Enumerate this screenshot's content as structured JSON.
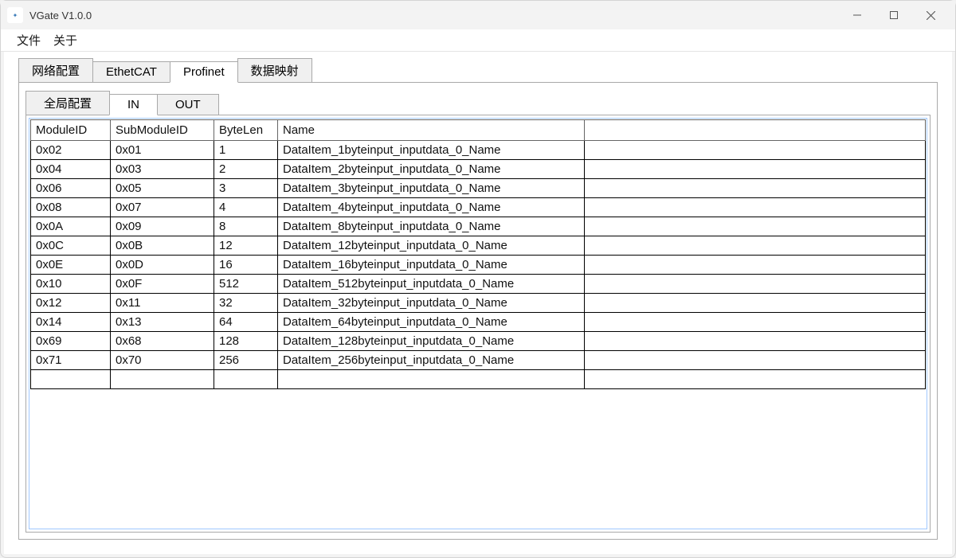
{
  "window": {
    "title": "VGate V1.0.0"
  },
  "menu": {
    "file": "文件",
    "about": "关于"
  },
  "tabs": {
    "network": "网络配置",
    "ethercat": "EthetCAT",
    "profinet": "Profinet",
    "mapping": "数据映射",
    "active": "profinet"
  },
  "subtabs": {
    "global": "全局配置",
    "in": "IN",
    "out": "OUT",
    "active": "in"
  },
  "table": {
    "headers": {
      "module": "ModuleID",
      "sub": "SubModuleID",
      "len": "ByteLen",
      "name": "Name"
    },
    "rows": [
      {
        "module": "0x02",
        "sub": "0x01",
        "len": "1",
        "name": "DataItem_1byteinput_inputdata_0_Name"
      },
      {
        "module": "0x04",
        "sub": "0x03",
        "len": "2",
        "name": "DataItem_2byteinput_inputdata_0_Name"
      },
      {
        "module": "0x06",
        "sub": "0x05",
        "len": "3",
        "name": "DataItem_3byteinput_inputdata_0_Name"
      },
      {
        "module": "0x08",
        "sub": "0x07",
        "len": "4",
        "name": "DataItem_4byteinput_inputdata_0_Name"
      },
      {
        "module": "0x0A",
        "sub": "0x09",
        "len": "8",
        "name": "DataItem_8byteinput_inputdata_0_Name"
      },
      {
        "module": "0x0C",
        "sub": "0x0B",
        "len": "12",
        "name": "DataItem_12byteinput_inputdata_0_Name"
      },
      {
        "module": "0x0E",
        "sub": "0x0D",
        "len": "16",
        "name": "DataItem_16byteinput_inputdata_0_Name"
      },
      {
        "module": "0x10",
        "sub": "0x0F",
        "len": "512",
        "name": "DataItem_512byteinput_inputdata_0_Name"
      },
      {
        "module": "0x12",
        "sub": "0x11",
        "len": "32",
        "name": "DataItem_32byteinput_inputdata_0_Name"
      },
      {
        "module": "0x14",
        "sub": "0x13",
        "len": "64",
        "name": "DataItem_64byteinput_inputdata_0_Name"
      },
      {
        "module": "0x69",
        "sub": "0x68",
        "len": "128",
        "name": "DataItem_128byteinput_inputdata_0_Name"
      },
      {
        "module": "0x71",
        "sub": "0x70",
        "len": "256",
        "name": "DataItem_256byteinput_inputdata_0_Name"
      }
    ]
  }
}
